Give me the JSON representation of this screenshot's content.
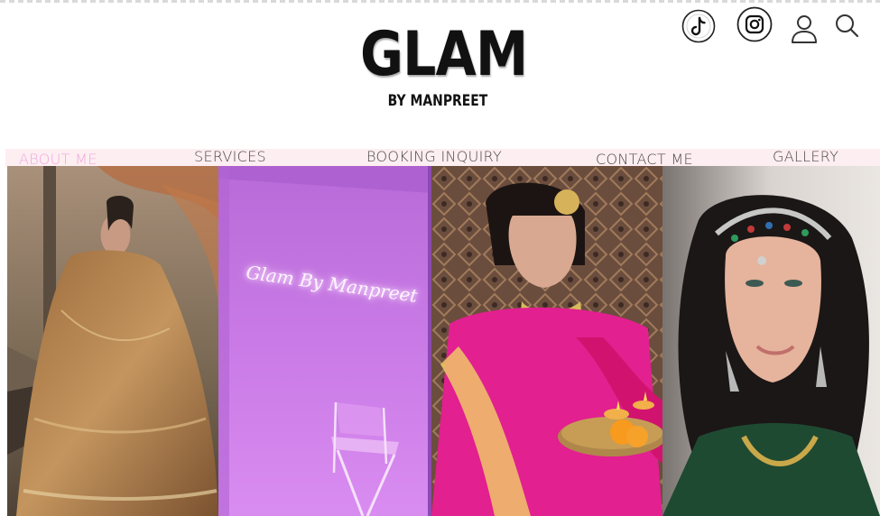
{
  "brand": {
    "title": "GLAM",
    "subtitle": "BY MANPREET"
  },
  "header_icons": [
    "tiktok-icon",
    "instagram-icon",
    "account-icon",
    "search-icon"
  ],
  "nav": {
    "items": [
      {
        "label": "ABOUT ME",
        "active": true
      },
      {
        "label": "SERVICES",
        "active": false
      },
      {
        "label": "BOOKING INQUIRY",
        "active": false
      },
      {
        "label": "CONTACT ME",
        "active": false
      },
      {
        "label": "GALLERY",
        "active": false
      }
    ]
  },
  "gallery": {
    "neon_sign": "Glam By Manpreet"
  },
  "colors": {
    "nav_bg": "#fdeef1",
    "active_nav": "#f0a7df",
    "neon_wall": "#c97ae6",
    "text": "#4a4a4a"
  }
}
